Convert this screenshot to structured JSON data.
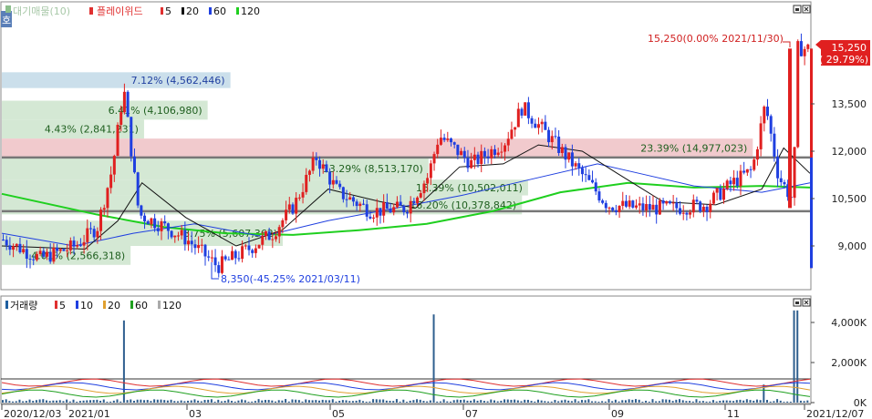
{
  "price_legend": {
    "toggle": "호",
    "vp_label": "대기매물(10)",
    "candle_label": "플레이위드",
    "ma": [
      {
        "label": "5",
        "color": "#e03030"
      },
      {
        "label": "20",
        "color": "#111111"
      },
      {
        "label": "60",
        "color": "#1f3fe0"
      },
      {
        "label": "120",
        "color": "#1fcf1f"
      }
    ]
  },
  "volume_legend": {
    "label": "거래량",
    "ma": [
      {
        "label": "5",
        "color": "#e03030"
      },
      {
        "label": "10",
        "color": "#1f3fe0"
      },
      {
        "label": "20",
        "color": "#e0a030"
      },
      {
        "label": "60",
        "color": "#1fa01f"
      },
      {
        "label": "120",
        "color": "#aaaaaa"
      }
    ]
  },
  "price_axis_ticks": [
    "13,500",
    "12,000",
    "10,500",
    "9,000"
  ],
  "volume_axis_ticks": [
    "4,000K",
    "2,000K",
    "0K"
  ],
  "date_ticks": [
    "2020/12/03",
    "2021/01",
    "03",
    "05",
    "07",
    "09",
    "11",
    "2021/12/07"
  ],
  "current_price_tag": {
    "price": "15,250",
    "change": "( 29.79%)"
  },
  "annotations": {
    "high": "15,250(0.00% 2021/11/30)",
    "low": "8,350(-45.25% 2021/03/11)"
  },
  "volume_profile": [
    {
      "label": "7.12% (4,562,446)"
    },
    {
      "label": "6.41% (4,106,980)"
    },
    {
      "label": "4.43% (2,841,231)"
    },
    {
      "label": "23.39% (14,977,023)"
    },
    {
      "label": "13.29% (8,513,170)"
    },
    {
      "label": "16.39% (10,502,011)"
    },
    {
      "label": "16.20% (10,378,842)"
    },
    {
      "label": "8.75% (5,607,362)"
    },
    {
      "label": "4.01% (2,566,318)"
    }
  ],
  "chart_data": {
    "type": "candlestick",
    "x_range": [
      "2020/12/03",
      "2021/12/07"
    ],
    "price_ylim": [
      8000,
      16000
    ],
    "volume_ylim": [
      0,
      4800
    ],
    "volume_unit": "K",
    "price_points": [
      [
        "2020/12/03",
        9200
      ],
      [
        "2020/12/20",
        8600
      ],
      [
        "2021/01/05",
        9000
      ],
      [
        "2021/01/15",
        9600
      ],
      [
        "2021/01/22",
        11500
      ],
      [
        "2021/01/27",
        14000
      ],
      [
        "2021/02/03",
        10000
      ],
      [
        "2021/02/15",
        9600
      ],
      [
        "2021/02/25",
        9200
      ],
      [
        "2021/03/11",
        8350
      ],
      [
        "2021/03/25",
        8900
      ],
      [
        "2021/04/05",
        9400
      ],
      [
        "2021/04/15",
        10300
      ],
      [
        "2021/04/25",
        11800
      ],
      [
        "2021/05/05",
        10700
      ],
      [
        "2021/05/20",
        10100
      ],
      [
        "2021/06/05",
        10200
      ],
      [
        "2021/06/15",
        11200
      ],
      [
        "2021/06/20",
        12500
      ],
      [
        "2021/06/25",
        12200
      ],
      [
        "2021/07/05",
        11600
      ],
      [
        "2021/07/20",
        12300
      ],
      [
        "2021/07/28",
        13400
      ],
      [
        "2021/08/10",
        12400
      ],
      [
        "2021/08/25",
        11200
      ],
      [
        "2021/09/05",
        10300
      ],
      [
        "2021/09/20",
        10200
      ],
      [
        "2021/10/05",
        10200
      ],
      [
        "2021/10/20",
        10300
      ],
      [
        "2021/11/01",
        11000
      ],
      [
        "2021/11/10",
        11400
      ],
      [
        "2021/11/16",
        13500
      ],
      [
        "2021/11/22",
        11200
      ],
      [
        "2021/11/29",
        10400
      ],
      [
        "2021/11/30",
        15250
      ]
    ],
    "ma20": [
      [
        "2020/12/03",
        9000
      ],
      [
        "2021/01/10",
        8900
      ],
      [
        "2021/01/25",
        9800
      ],
      [
        "2021/02/05",
        11000
      ],
      [
        "2021/02/25",
        9900
      ],
      [
        "2021/03/20",
        9000
      ],
      [
        "2021/04/10",
        9500
      ],
      [
        "2021/05/01",
        10800
      ],
      [
        "2021/05/25",
        10400
      ],
      [
        "2021/06/10",
        10200
      ],
      [
        "2021/06/30",
        11500
      ],
      [
        "2021/07/20",
        11600
      ],
      [
        "2021/08/05",
        12200
      ],
      [
        "2021/08/25",
        12000
      ],
      [
        "2021/09/10",
        11300
      ],
      [
        "2021/10/01",
        10400
      ],
      [
        "2021/10/25",
        10300
      ],
      [
        "2021/11/15",
        10800
      ],
      [
        "2021/11/25",
        12100
      ],
      [
        "2021/12/07",
        11300
      ]
    ],
    "ma60": [
      [
        "2020/12/03",
        9400
      ],
      [
        "2021/01/05",
        9000
      ],
      [
        "2021/02/01",
        9400
      ],
      [
        "2021/03/01",
        9700
      ],
      [
        "2021/04/01",
        9300
      ],
      [
        "2021/05/01",
        9800
      ],
      [
        "2021/06/01",
        10200
      ],
      [
        "2021/07/01",
        10600
      ],
      [
        "2021/08/01",
        11100
      ],
      [
        "2021/09/01",
        11600
      ],
      [
        "2021/09/20",
        11300
      ],
      [
        "2021/10/15",
        10900
      ],
      [
        "2021/11/15",
        10700
      ],
      [
        "2021/12/07",
        11000
      ]
    ],
    "ma120": [
      [
        "2020/12/03",
        10650
      ],
      [
        "2021/01/15",
        10000
      ],
      [
        "2021/02/15",
        9600
      ],
      [
        "2021/03/15",
        9400
      ],
      [
        "2021/04/15",
        9350
      ],
      [
        "2021/05/15",
        9500
      ],
      [
        "2021/06/15",
        9700
      ],
      [
        "2021/07/15",
        10100
      ],
      [
        "2021/08/15",
        10700
      ],
      [
        "2021/09/15",
        11000
      ],
      [
        "2021/10/15",
        10850
      ],
      [
        "2021/11/15",
        10900
      ],
      [
        "2021/12/07",
        10850
      ]
    ],
    "volume_profile_bars": [
      {
        "low": 14000,
        "high": 14500,
        "pct": 7.12
      },
      {
        "low": 13000,
        "high": 13600,
        "pct": 6.41
      },
      {
        "low": 12400,
        "high": 13000,
        "pct": 4.43
      },
      {
        "low": 11800,
        "high": 12400,
        "pct": 23.39
      },
      {
        "low": 11100,
        "high": 11800,
        "pct": 13.29
      },
      {
        "low": 10600,
        "high": 11100,
        "pct": 16.39
      },
      {
        "low": 10000,
        "high": 10600,
        "pct": 16.2
      },
      {
        "low": 9000,
        "high": 9800,
        "pct": 8.75
      },
      {
        "low": 8400,
        "high": 9000,
        "pct": 4.01
      }
    ],
    "horizontal_lines": [
      11800,
      10100
    ],
    "volume_spikes": [
      [
        "2021/01/27",
        4100
      ],
      [
        "2021/06/18",
        4400
      ],
      [
        "2021/11/16",
        900
      ],
      [
        "2021/11/30",
        4600
      ]
    ]
  }
}
